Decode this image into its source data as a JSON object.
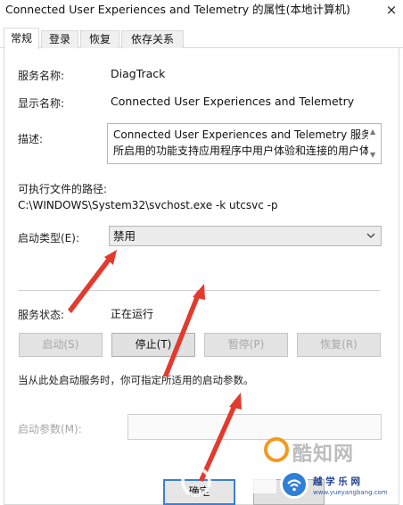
{
  "window": {
    "title": "Connected User Experiences and Telemetry 的属性(本地计算机)",
    "close_glyph": "×"
  },
  "tabs": [
    {
      "label": "常规",
      "active": true
    },
    {
      "label": "登录",
      "active": false
    },
    {
      "label": "恢复",
      "active": false
    },
    {
      "label": "依存关系",
      "active": false
    }
  ],
  "general": {
    "service_name_label": "服务名称:",
    "service_name_value": "DiagTrack",
    "display_name_label": "显示名称:",
    "display_name_value": "Connected User Experiences and Telemetry",
    "description_label": "描述:",
    "description_line1": "Connected User Experiences and Telemetry 服务",
    "description_line2": "所启用的功能支持应用程序中用户体验和连接的用户体",
    "exe_path_label": "可执行文件的路径:",
    "exe_path_value": "C:\\WINDOWS\\System32\\svchost.exe -k utcsvc -p",
    "startup_type_label": "启动类型(E):",
    "startup_type_value": "禁用",
    "status_label": "服务状态:",
    "status_value": "正在运行",
    "hint_text": "当从此处启动服务时，你可指定所适用的启动参数。",
    "start_params_label": "启动参数(M):"
  },
  "buttons": {
    "start": {
      "label": "启动(S)",
      "enabled": false
    },
    "stop": {
      "label": "停止(T)",
      "enabled": true
    },
    "pause": {
      "label": "暂停(P)",
      "enabled": false
    },
    "resume": {
      "label": "恢复(R)",
      "enabled": false
    },
    "ok": {
      "label": "确定"
    }
  },
  "watermarks": {
    "cn_text": "酷知网",
    "brand_text": "越 学 乐 网",
    "url_text": "www.yueyangbang.com"
  },
  "colors": {
    "annotation_arrow": "#e23b2e",
    "ok_focus_border": "#3c7fd6",
    "wm_orange": "#f39a1e",
    "wm_blue": "#2f7fd6"
  }
}
